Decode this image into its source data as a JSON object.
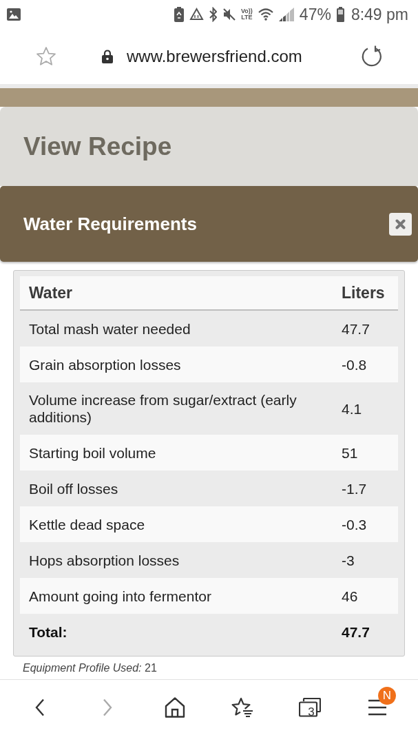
{
  "status_bar": {
    "volte": {
      "top": "Vo))",
      "bottom": "LTE"
    },
    "battery_percent": "47%",
    "time": "8:49 pm"
  },
  "address_bar": {
    "url": "www.brewersfriend.com"
  },
  "page": {
    "title": "View Recipe"
  },
  "dialog": {
    "title": "Water Requirements",
    "table": {
      "columns": [
        "Water",
        "Liters"
      ],
      "rows": [
        {
          "kind": "item",
          "label": "Total mash water needed",
          "value": "47.7"
        },
        {
          "kind": "item",
          "label": "Grain absorption losses",
          "value": "-0.8"
        },
        {
          "kind": "item",
          "label": "Volume increase from sugar/extract (early additions)",
          "value": "4.1"
        },
        {
          "kind": "item",
          "label": "Starting boil volume",
          "value": "51"
        },
        {
          "kind": "item",
          "label": "Boil off losses",
          "value": "-1.7"
        },
        {
          "kind": "item",
          "label": "Kettle dead space",
          "value": "-0.3"
        },
        {
          "kind": "item",
          "label": "Hops absorption losses",
          "value": "-3"
        },
        {
          "kind": "item",
          "label": "Amount going into fermentor",
          "value": "46"
        },
        {
          "kind": "total",
          "label": "Total:",
          "value": "47.7"
        }
      ]
    },
    "footnote": "*Equipment Profile Used:* 21"
  },
  "bottom_nav": {
    "items": [
      {
        "kind": "back",
        "disabled": false
      },
      {
        "kind": "forward",
        "disabled": true
      },
      {
        "kind": "home",
        "disabled": false
      },
      {
        "kind": "bookmarks",
        "disabled": false
      },
      {
        "kind": "tabs",
        "disabled": false,
        "count": "3"
      },
      {
        "kind": "menu",
        "disabled": false,
        "badge": "N"
      }
    ]
  }
}
